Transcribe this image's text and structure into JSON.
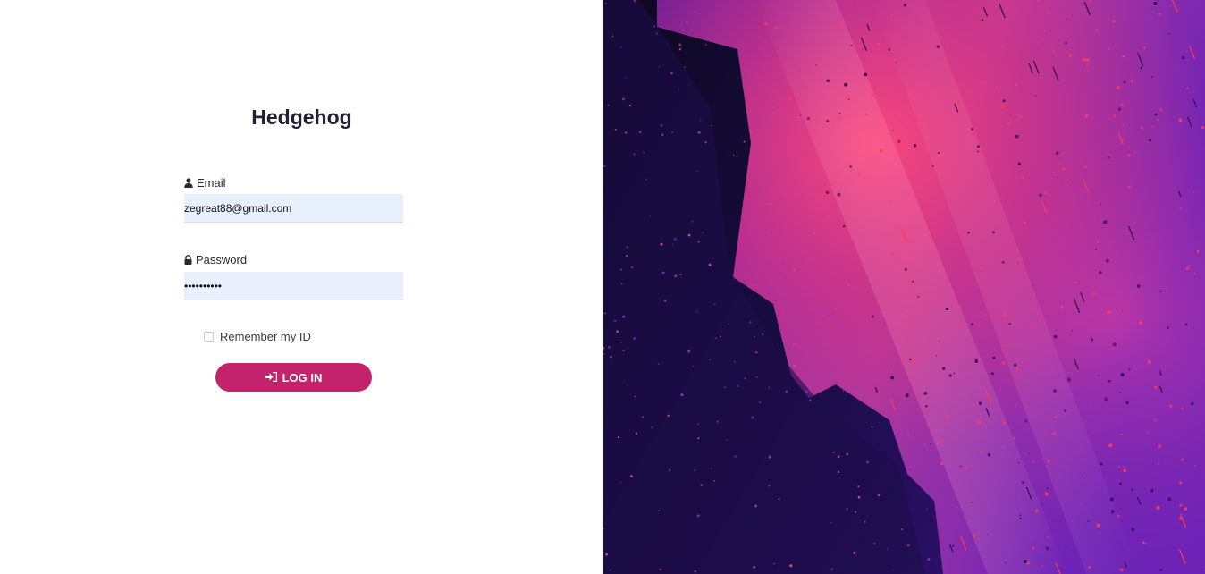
{
  "app": {
    "title": "Hedgehog"
  },
  "form": {
    "email_label": "Email",
    "email_value": "zegreat88@gmail.com",
    "password_label": "Password",
    "password_value": "••••••••••",
    "remember_label": "Remember my ID",
    "remember_checked": false,
    "login_label": "LOG IN"
  },
  "icons": {
    "email": "user-icon",
    "password": "lock-icon",
    "login": "sign-in-icon"
  },
  "colors": {
    "accent": "#c2236b",
    "input_background": "#e8f0fe",
    "title_text": "#1e2233",
    "hero_dark": "#1a0a3a",
    "hero_purple": "#5b1fa8",
    "hero_pink": "#e0356f"
  }
}
